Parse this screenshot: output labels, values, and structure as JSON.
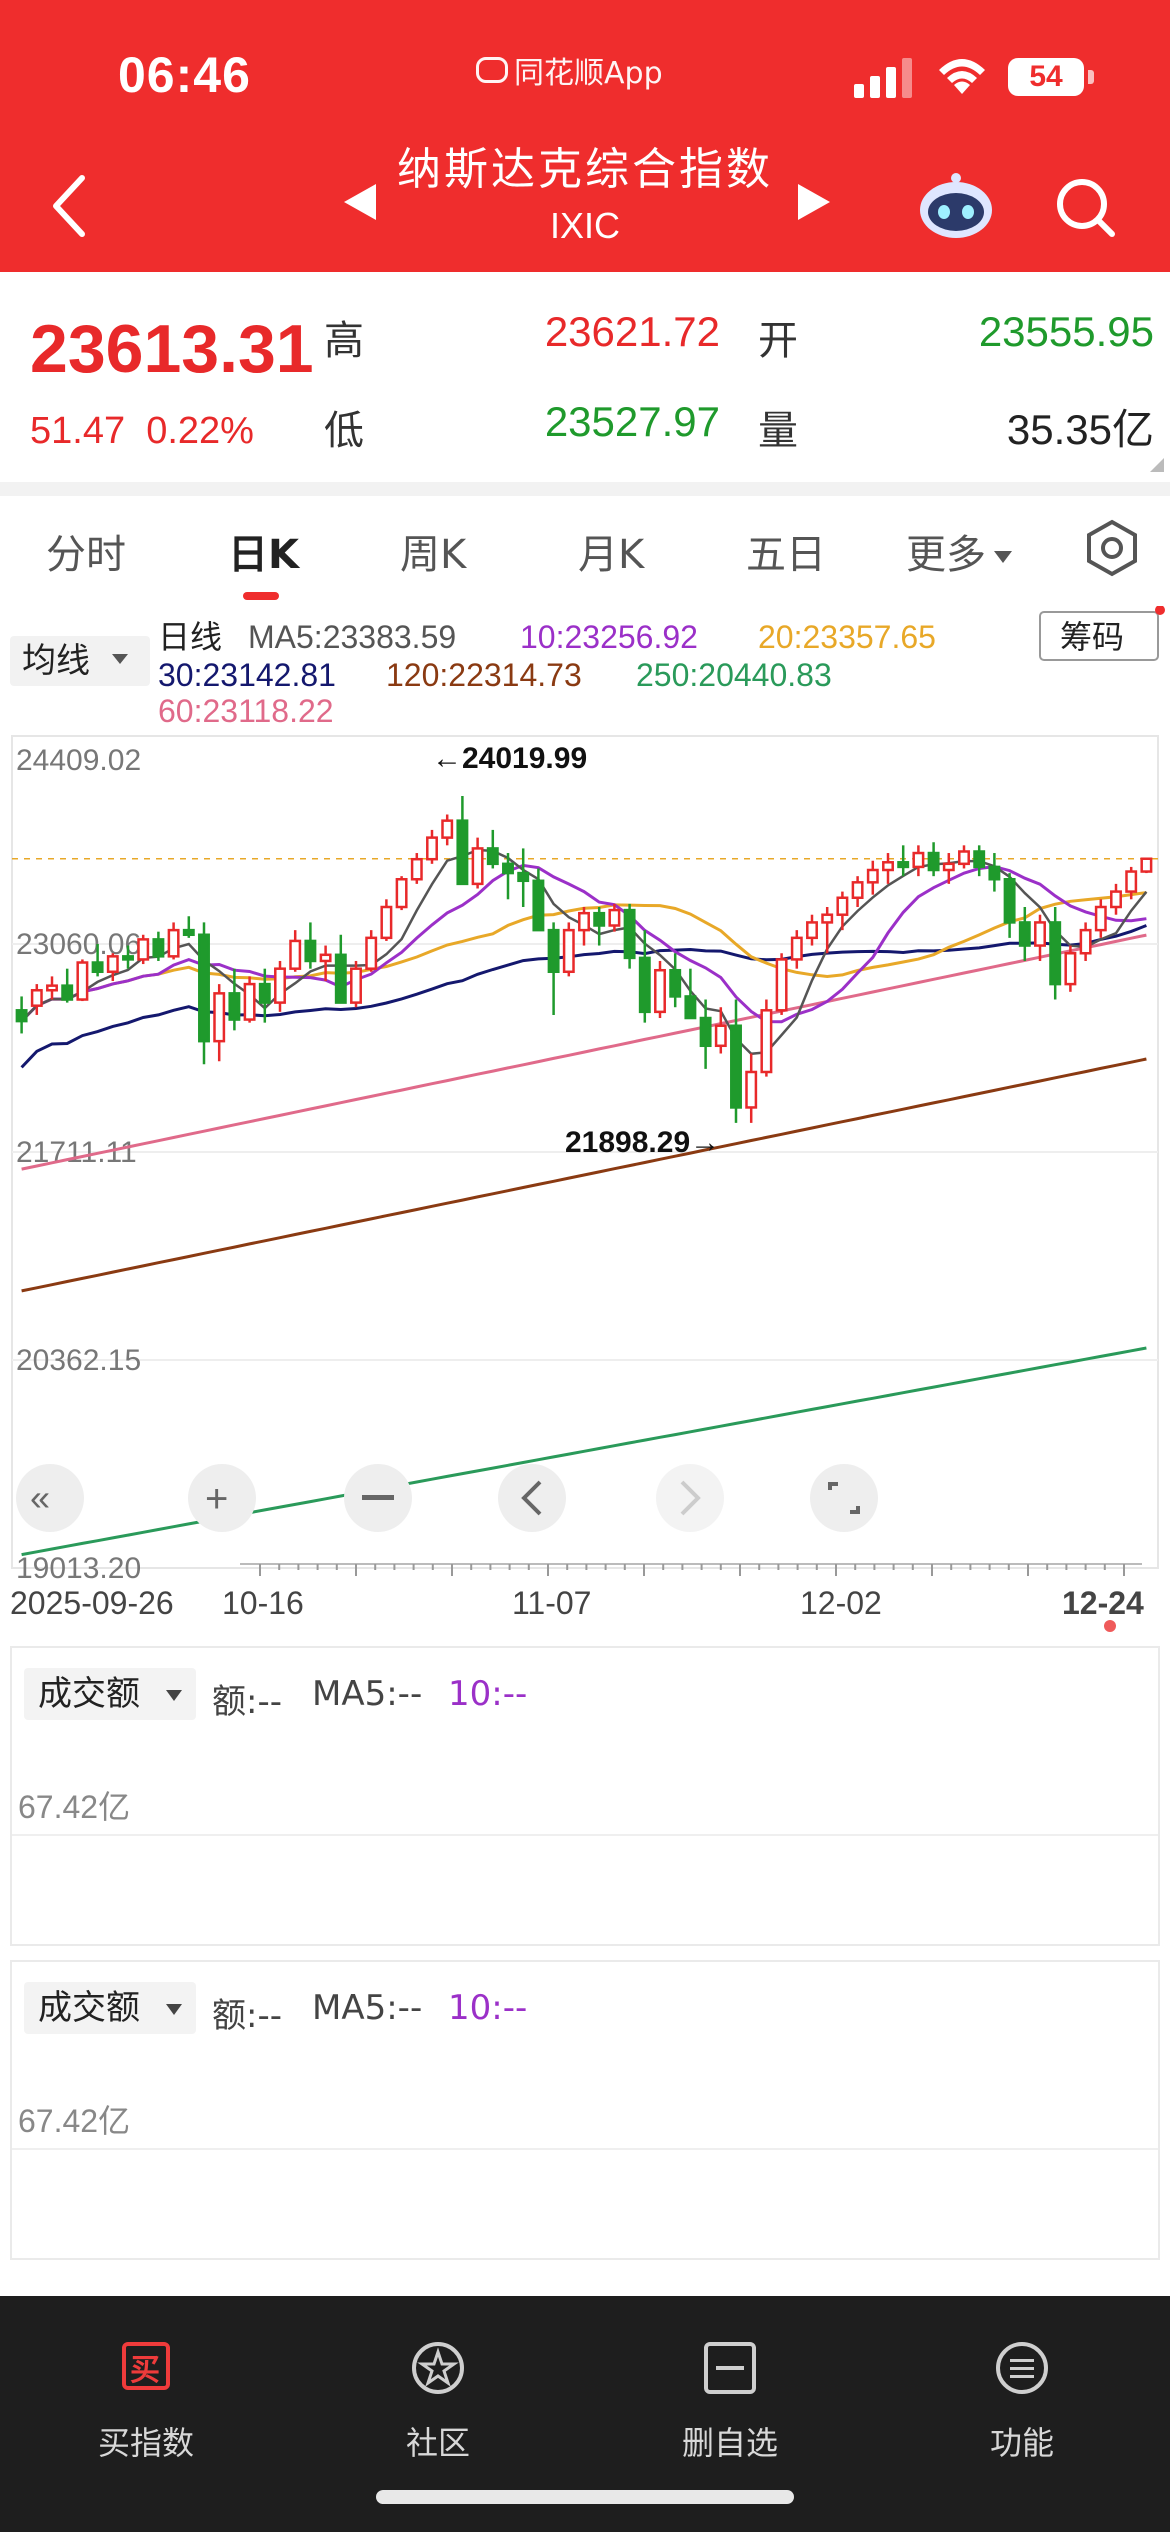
{
  "status_bar": {
    "time": "06:46",
    "app_name": "同花顺App",
    "battery": "54"
  },
  "header": {
    "title": "纳斯达克综合指数",
    "code": "IXIC"
  },
  "quote": {
    "price": "23613.31",
    "change": "51.47",
    "change_pct": "0.22%",
    "high_label": "高",
    "high": "23621.72",
    "open_label": "开",
    "open": "23555.95",
    "low_label": "低",
    "low": "23527.97",
    "volume_label": "量",
    "volume": "35.35亿"
  },
  "tabs": [
    "分时",
    "日K",
    "周K",
    "月K",
    "五日",
    "更多"
  ],
  "chart_header": {
    "ma_select": "均线",
    "period": "日线",
    "ma5": "MA5:23383.59",
    "ma10": "10:23256.92",
    "ma20": "20:23357.65",
    "ma30": "30:23142.81",
    "ma120": "120:22314.73",
    "ma250": "250:20440.83",
    "ma60": "60:23118.22",
    "chips_button": "筹码"
  },
  "colors": {
    "up": "#e8292a",
    "down": "#1f9a2c",
    "ma5": "#555555",
    "ma10": "#9b30c8",
    "ma20": "#e8a828",
    "ma30": "#14186e",
    "ma60": "#e06a8a",
    "ma120": "#8a3a12",
    "ma250": "#2a9a5a"
  },
  "chart_data": {
    "type": "candlestick",
    "y_ticks": [
      "24409.02",
      "23060.06",
      "21711.11",
      "20362.15",
      "19013.20"
    ],
    "x_ticks": [
      "2025-09-26",
      "10-16",
      "11-07",
      "12-02",
      "12-24"
    ],
    "annotations": {
      "high": "←24019.99",
      "low": "21898.29→"
    },
    "ohlc": [
      [
        22630,
        22720,
        22480,
        22560
      ],
      [
        22660,
        22800,
        22600,
        22760
      ],
      [
        22760,
        22850,
        22700,
        22790
      ],
      [
        22790,
        22900,
        22680,
        22700
      ],
      [
        22700,
        22960,
        22690,
        22940
      ],
      [
        22940,
        23060,
        22850,
        22880
      ],
      [
        22880,
        23000,
        22820,
        22980
      ],
      [
        22980,
        23050,
        22900,
        22960
      ],
      [
        22960,
        23120,
        22930,
        23090
      ],
      [
        23090,
        23140,
        22950,
        22980
      ],
      [
        22980,
        23200,
        22960,
        23150
      ],
      [
        23150,
        23240,
        23100,
        23120
      ],
      [
        23120,
        23200,
        22280,
        22430
      ],
      [
        22430,
        22800,
        22300,
        22740
      ],
      [
        22740,
        22900,
        22500,
        22570
      ],
      [
        22570,
        22850,
        22550,
        22800
      ],
      [
        22800,
        22900,
        22550,
        22680
      ],
      [
        22680,
        22950,
        22620,
        22900
      ],
      [
        22900,
        23150,
        22880,
        23080
      ],
      [
        23080,
        23200,
        22900,
        22950
      ],
      [
        22950,
        23050,
        22820,
        22990
      ],
      [
        22990,
        23120,
        22950,
        22680
      ],
      [
        22680,
        22950,
        22650,
        22900
      ],
      [
        22900,
        23150,
        22880,
        23100
      ],
      [
        23100,
        23350,
        23080,
        23300
      ],
      [
        23300,
        23500,
        23280,
        23480
      ],
      [
        23480,
        23650,
        23450,
        23610
      ],
      [
        23610,
        23800,
        23580,
        23750
      ],
      [
        23750,
        23900,
        23700,
        23860
      ],
      [
        23860,
        24020,
        23820,
        23450
      ],
      [
        23450,
        23750,
        23420,
        23680
      ],
      [
        23680,
        23800,
        23550,
        23580
      ],
      [
        23580,
        23650,
        23350,
        23520
      ],
      [
        23520,
        23680,
        23300,
        23470
      ],
      [
        23470,
        23550,
        23300,
        23150
      ],
      [
        23150,
        23200,
        22600,
        22880
      ],
      [
        22880,
        23200,
        22850,
        23150
      ],
      [
        23150,
        23300,
        23050,
        23260
      ],
      [
        23260,
        23300,
        23050,
        23180
      ],
      [
        23180,
        23320,
        23140,
        23280
      ],
      [
        23280,
        23320,
        22900,
        22970
      ],
      [
        22970,
        23150,
        22550,
        22620
      ],
      [
        22620,
        22950,
        22580,
        22890
      ],
      [
        22890,
        23000,
        22650,
        22720
      ],
      [
        22720,
        22900,
        22620,
        22580
      ],
      [
        22580,
        22700,
        22250,
        22400
      ],
      [
        22400,
        22650,
        22350,
        22530
      ],
      [
        22530,
        22700,
        21900,
        22000
      ],
      [
        22000,
        22350,
        21900,
        22230
      ],
      [
        22230,
        22700,
        22200,
        22630
      ],
      [
        22630,
        23000,
        22600,
        22960
      ],
      [
        22960,
        23150,
        22900,
        23100
      ],
      [
        23100,
        23250,
        23050,
        23200
      ],
      [
        23200,
        23300,
        23000,
        23250
      ],
      [
        23250,
        23400,
        23150,
        23360
      ],
      [
        23360,
        23500,
        23300,
        23460
      ],
      [
        23460,
        23600,
        23380,
        23540
      ],
      [
        23540,
        23650,
        23450,
        23590
      ],
      [
        23590,
        23700,
        23500,
        23560
      ],
      [
        23560,
        23700,
        23500,
        23650
      ],
      [
        23650,
        23720,
        23500,
        23540
      ],
      [
        23540,
        23650,
        23450,
        23580
      ],
      [
        23580,
        23700,
        23550,
        23660
      ],
      [
        23660,
        23700,
        23500,
        23560
      ],
      [
        23560,
        23650,
        23400,
        23480
      ],
      [
        23480,
        23520,
        23100,
        23200
      ],
      [
        23200,
        23300,
        22950,
        23050
      ],
      [
        23050,
        23250,
        22950,
        23200
      ],
      [
        23200,
        23300,
        22700,
        22800
      ],
      [
        22800,
        23050,
        22750,
        23000
      ],
      [
        23000,
        23200,
        22950,
        23150
      ],
      [
        23150,
        23350,
        23100,
        23300
      ],
      [
        23300,
        23450,
        23250,
        23400
      ],
      [
        23400,
        23560,
        23350,
        23530
      ],
      [
        23530,
        23620,
        23520,
        23613
      ]
    ]
  },
  "volume_panels": [
    {
      "select": "成交额",
      "amount": "额:--",
      "ma5": "MA5:--",
      "ma10": "10:--",
      "scale": "67.42亿"
    },
    {
      "select": "成交额",
      "amount": "额:--",
      "ma5": "MA5:--",
      "ma10": "10:--",
      "scale": "67.42亿"
    }
  ],
  "bottom_nav": [
    {
      "label": "买指数",
      "icon": "买"
    },
    {
      "label": "社区",
      "icon": ""
    },
    {
      "label": "删自选",
      "icon": ""
    },
    {
      "label": "功能",
      "icon": ""
    }
  ]
}
